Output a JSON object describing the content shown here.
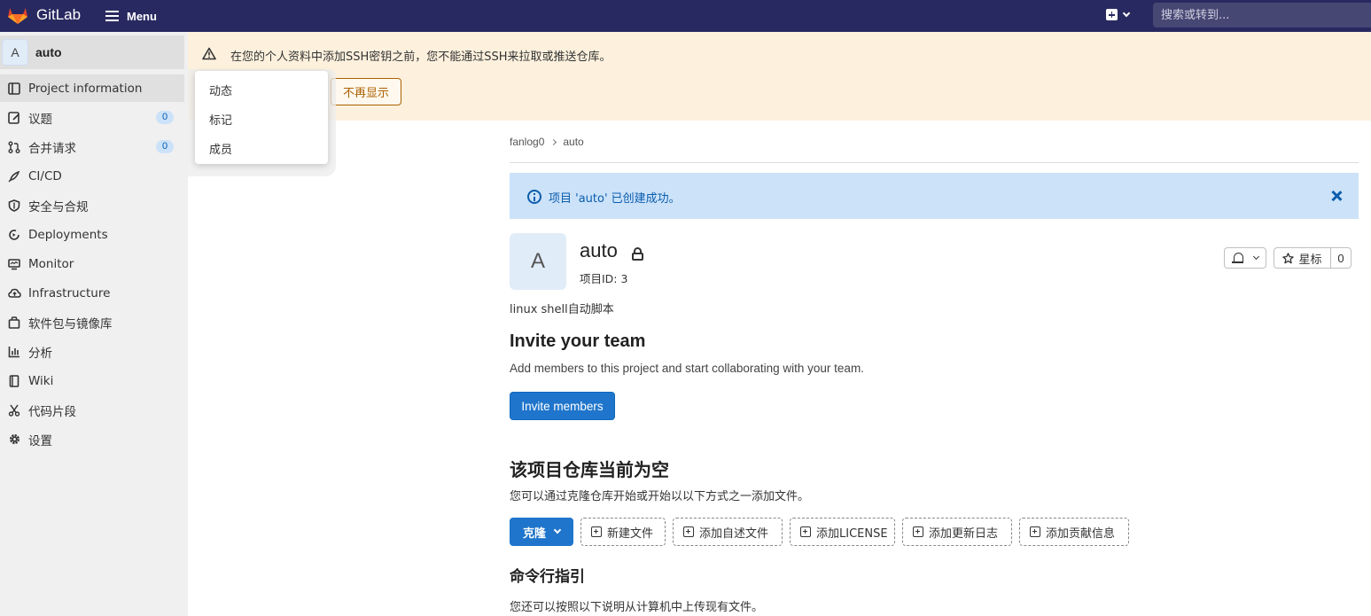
{
  "topbar": {
    "brand": "GitLab",
    "menu_label": "Menu",
    "search_placeholder": "搜索或转到...",
    "colors": {
      "navbar": "#292961",
      "logo": "#e24329"
    }
  },
  "sidebar": {
    "project_initial": "A",
    "project_name": "auto",
    "items": [
      {
        "label": "Project information",
        "icon": "project-info-icon",
        "active": true
      },
      {
        "label": "议题",
        "icon": "issues-icon",
        "badge": "0"
      },
      {
        "label": "合并请求",
        "icon": "merge-request-icon",
        "badge": "0"
      },
      {
        "label": "CI/CD",
        "icon": "rocket-icon"
      },
      {
        "label": "安全与合规",
        "icon": "shield-icon"
      },
      {
        "label": "Deployments",
        "icon": "deployments-icon"
      },
      {
        "label": "Monitor",
        "icon": "monitor-icon"
      },
      {
        "label": "Infrastructure",
        "icon": "cloud-icon"
      },
      {
        "label": "软件包与镜像库",
        "icon": "package-icon"
      },
      {
        "label": "分析",
        "icon": "chart-icon"
      },
      {
        "label": "Wiki",
        "icon": "book-icon"
      },
      {
        "label": "代码片段",
        "icon": "snippet-icon"
      },
      {
        "label": "设置",
        "icon": "settings-icon"
      }
    ]
  },
  "flyout": {
    "items": [
      "动态",
      "标记",
      "成员"
    ]
  },
  "ssh_alert": {
    "text": "在您的个人资料中添加SSH密钥之前，您不能通过SSH来拉取或推送仓库。",
    "dismiss_label": "不再显示"
  },
  "breadcrumb": {
    "group": "fanlog0",
    "project": "auto"
  },
  "info_alert": {
    "text": "项目 'auto' 已创建成功。"
  },
  "project": {
    "initial": "A",
    "name": "auto",
    "id_text": "项目ID: 3",
    "description": "linux shell自动脚本",
    "star_label": "星标",
    "star_count": "0"
  },
  "invite": {
    "heading": "Invite your team",
    "text": "Add members to this project and start collaborating with your team.",
    "button": "Invite members"
  },
  "empty_repo": {
    "heading": "该项目仓库当前为空",
    "text": "您可以通过克隆仓库开始或开始以以下方式之一添加文件。",
    "clone_label": "克隆",
    "actions": [
      "新建文件",
      "添加自述文件",
      "添加LICENSE",
      "添加更新日志",
      "添加贡献信息"
    ]
  },
  "command_line": {
    "heading": "命令行指引",
    "text": "您还可以按照以下说明从计算机中上传现有文件。"
  }
}
